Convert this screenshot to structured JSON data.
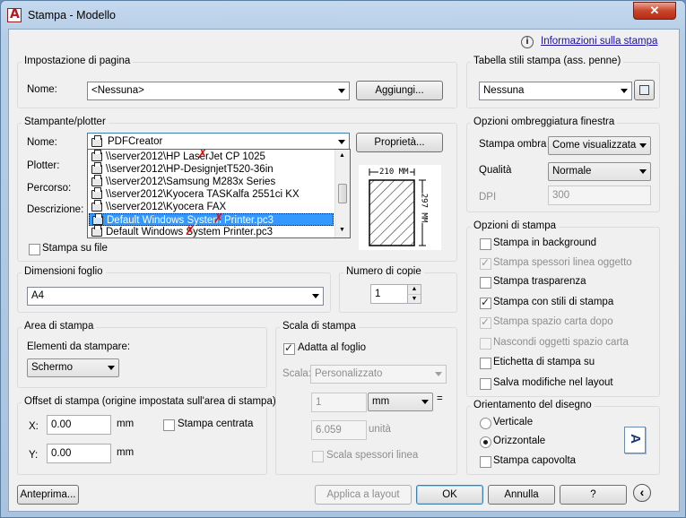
{
  "window": {
    "title": "Stampa - Modello",
    "close_glyph": "✕"
  },
  "info_link": "Informazioni sulla stampa",
  "page_setup": {
    "title": "Impostazione di pagina",
    "name_label": "Nome:",
    "name_value": "<Nessuna>",
    "add_button": "Aggiungi..."
  },
  "printer": {
    "title": "Stampante/plotter",
    "name_label": "Nome:",
    "name_value": "PDFCreator",
    "properties_button": "Proprietà...",
    "plotter_label": "Plotter:",
    "path_label": "Percorso:",
    "description_label": "Descrizione:",
    "print_to_file": "Stampa su file",
    "preview_width": "210 MM",
    "preview_height": "297 MM",
    "dropdown_items": [
      "\\\\server2012\\HP LaserJet CP 1025",
      "\\\\server2012\\HP-DesignjetT520-36in",
      "\\\\server2012\\Samsung M283x Series",
      "\\\\server2012\\Kyocera TASKalfa 2551ci KX",
      "\\\\server2012\\Kyocera FAX",
      "Default Windows System Printer.pc3",
      "Default Windows System Printer.pc3"
    ]
  },
  "paper_size": {
    "title": "Dimensioni foglio",
    "value": "A4"
  },
  "copies": {
    "title": "Numero di copie",
    "value": "1"
  },
  "print_area": {
    "title": "Area di stampa",
    "what_label": "Elementi da stampare:",
    "what_value": "Schermo"
  },
  "offset": {
    "title": "Offset di stampa (origine impostata sull'area di stampa)",
    "x_label": "X:",
    "x_value": "0.00",
    "x_unit": "mm",
    "y_label": "Y:",
    "y_value": "0.00",
    "y_unit": "mm",
    "center_label": "Stampa centrata"
  },
  "scale": {
    "title": "Scala di stampa",
    "fit_label": "Adatta al foglio",
    "scale_label": "Scala:",
    "scale_value": "Personalizzato",
    "value1": "1",
    "unit1": "mm",
    "equals": "=",
    "value2": "6.059",
    "unit2": "unità",
    "lineweights_label": "Scala spessori linea"
  },
  "style_table": {
    "title": "Tabella stili stampa (ass. penne)",
    "value": "Nessuna"
  },
  "shaded": {
    "title": "Opzioni ombreggiatura finestra",
    "shade_label": "Stampa ombra",
    "shade_value": "Come visualizzata",
    "quality_label": "Qualità",
    "quality_value": "Normale",
    "dpi_label": "DPI",
    "dpi_value": "300"
  },
  "options": {
    "title": "Opzioni di stampa",
    "items": [
      "Stampa in background",
      "Stampa spessori linea oggetto",
      "Stampa trasparenza",
      "Stampa con stili di stampa",
      "Stampa spazio carta dopo",
      "Nascondi oggetti spazio carta",
      "Etichetta di stampa su",
      "Salva modifiche nel layout"
    ]
  },
  "orientation": {
    "title": "Orientamento del disegno",
    "portrait": "Verticale",
    "landscape": "Orizzontale",
    "upside_down": "Stampa capovolta",
    "icon_letter": "A"
  },
  "footer": {
    "preview_button": "Anteprima...",
    "apply_button": "Applica a layout",
    "ok_button": "OK",
    "cancel_button": "Annulla",
    "help_button": "?",
    "collapse_glyph": "‹"
  }
}
